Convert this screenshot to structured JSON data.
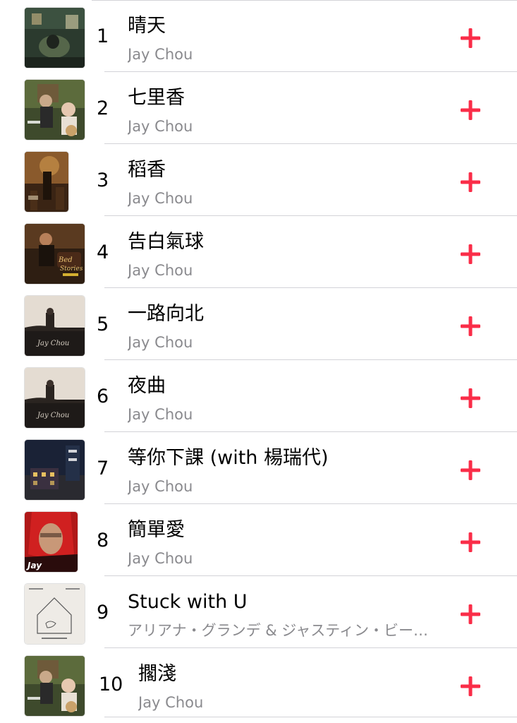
{
  "tracks": [
    {
      "rank": "1",
      "title": "晴天",
      "artist": "Jay Chou",
      "artwork": "album-cover-qing-tian",
      "add_icon": "plus-icon"
    },
    {
      "rank": "2",
      "title": "七里香",
      "artist": "Jay Chou",
      "artwork": "album-cover-qi-li-xiang",
      "add_icon": "plus-icon"
    },
    {
      "rank": "3",
      "title": "稻香",
      "artist": "Jay Chou",
      "artwork": "album-cover-mo-jie",
      "add_icon": "plus-icon"
    },
    {
      "rank": "4",
      "title": "告白氣球",
      "artist": "Jay Chou",
      "artwork": "album-cover-bedtime-stories",
      "add_icon": "plus-icon"
    },
    {
      "rank": "5",
      "title": "一路向北",
      "artist": "Jay Chou",
      "artwork": "album-cover-jay-chou-1",
      "add_icon": "plus-icon"
    },
    {
      "rank": "6",
      "title": "夜曲",
      "artist": "Jay Chou",
      "artwork": "album-cover-jay-chou-2",
      "add_icon": "plus-icon"
    },
    {
      "rank": "7",
      "title": "等你下課 (with 楊瑞代)",
      "artist": "Jay Chou",
      "artwork": "album-cover-deng-ni-xia-ke",
      "add_icon": "plus-icon"
    },
    {
      "rank": "8",
      "title": "簡單愛",
      "artist": "Jay Chou",
      "artwork": "album-cover-jay-red-hood",
      "add_icon": "plus-icon"
    },
    {
      "rank": "9",
      "title": "Stuck with U",
      "artist": "アリアナ・グランデ & ジャスティン・ビー…",
      "artwork": "album-cover-stuck-with-u",
      "add_icon": "plus-icon"
    },
    {
      "rank": "10",
      "title": "擱淺",
      "artist": "Jay Chou",
      "artwork": "album-cover-qi-li-xiang",
      "add_icon": "plus-icon"
    }
  ],
  "colors": {
    "accent": "#fa2d48",
    "secondary_text": "#8a8a8e",
    "divider": "#d3d3d8"
  }
}
